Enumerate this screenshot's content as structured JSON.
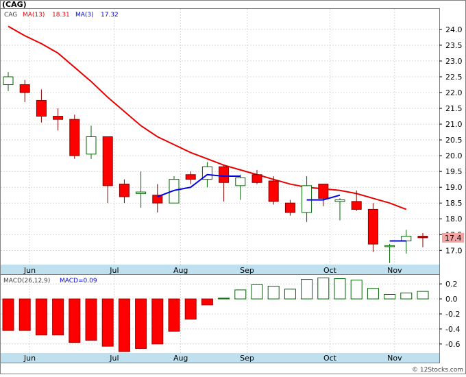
{
  "title": "(CAG)",
  "watermark": "© 12Stocks.com",
  "colors": {
    "up_candle": "#006400",
    "down_candle": "#ff0000",
    "ma13": "#e60000",
    "ma3": "#0000e6",
    "macd_positive": "#006400",
    "macd_negative": "#ff0000",
    "axis_band": "#bfe0ee",
    "price_tag_bg": "#f4a3a3",
    "grid": "#c0c0c0"
  },
  "chart_data": [
    {
      "type": "candlestick",
      "legend": {
        "symbol": "CAG",
        "ma13_label": "MA(13)",
        "ma13_value": "18.31",
        "ma3_label": "MA(3)",
        "ma3_value": "17.32"
      },
      "y_ticks": [
        "24.0",
        "23.5",
        "23.0",
        "22.5",
        "22.0",
        "21.5",
        "21.0",
        "20.5",
        "20.0",
        "19.5",
        "19.0",
        "18.5",
        "18.0",
        "17.5",
        "17.0"
      ],
      "ylim": [
        16.55,
        24.65
      ],
      "month_labels": [
        {
          "label": "Jun",
          "week": 1.3
        },
        {
          "label": "Jul",
          "week": 6.4
        },
        {
          "label": "Aug",
          "week": 10.4
        },
        {
          "label": "Sep",
          "week": 14.4
        },
        {
          "label": "Oct",
          "week": 19.4
        },
        {
          "label": "Nov",
          "week": 23.3
        }
      ],
      "last_price": "17.4",
      "last_price_value": 17.4,
      "candles": [
        {
          "o": 22.25,
          "h": 22.65,
          "l": 22.05,
          "c": 22.5
        },
        {
          "o": 22.25,
          "h": 22.4,
          "l": 21.7,
          "c": 22.0
        },
        {
          "o": 21.75,
          "h": 22.1,
          "l": 21.05,
          "c": 21.25
        },
        {
          "o": 21.25,
          "h": 21.5,
          "l": 20.8,
          "c": 21.15
        },
        {
          "o": 21.15,
          "h": 21.3,
          "l": 19.9,
          "c": 20.0
        },
        {
          "o": 20.05,
          "h": 20.95,
          "l": 19.9,
          "c": 20.6
        },
        {
          "o": 20.6,
          "h": 20.6,
          "l": 18.5,
          "c": 19.05
        },
        {
          "o": 19.1,
          "h": 19.25,
          "l": 18.5,
          "c": 18.7
        },
        {
          "o": 18.8,
          "h": 19.5,
          "l": 18.35,
          "c": 18.85
        },
        {
          "o": 18.75,
          "h": 19.1,
          "l": 18.2,
          "c": 18.5
        },
        {
          "o": 18.5,
          "h": 19.35,
          "l": 18.5,
          "c": 19.25
        },
        {
          "o": 19.4,
          "h": 19.5,
          "l": 19.1,
          "c": 19.25
        },
        {
          "o": 19.25,
          "h": 19.8,
          "l": 19.0,
          "c": 19.65
        },
        {
          "o": 19.65,
          "h": 19.7,
          "l": 18.55,
          "c": 19.15
        },
        {
          "o": 19.05,
          "h": 19.4,
          "l": 18.6,
          "c": 19.3
        },
        {
          "o": 19.4,
          "h": 19.55,
          "l": 19.1,
          "c": 19.15
        },
        {
          "o": 19.2,
          "h": 19.35,
          "l": 18.45,
          "c": 18.55
        },
        {
          "o": 18.5,
          "h": 18.6,
          "l": 18.1,
          "c": 18.2
        },
        {
          "o": 18.2,
          "h": 19.35,
          "l": 17.9,
          "c": 19.05
        },
        {
          "o": 19.1,
          "h": 19.1,
          "l": 18.4,
          "c": 18.65
        },
        {
          "o": 18.55,
          "h": 18.65,
          "l": 17.95,
          "c": 18.6
        },
        {
          "o": 18.55,
          "h": 18.9,
          "l": 18.25,
          "c": 18.3
        },
        {
          "o": 18.3,
          "h": 18.5,
          "l": 16.95,
          "c": 17.2
        },
        {
          "o": 17.15,
          "h": 17.2,
          "l": 16.6,
          "c": 17.15
        },
        {
          "o": 17.3,
          "h": 17.65,
          "l": 16.9,
          "c": 17.45
        },
        {
          "o": 17.45,
          "h": 17.55,
          "l": 17.1,
          "c": 17.4
        }
      ],
      "ma13": [
        24.1,
        23.8,
        23.55,
        23.25,
        22.8,
        22.35,
        21.85,
        21.4,
        20.95,
        20.6,
        20.35,
        20.1,
        19.9,
        19.7,
        19.55,
        19.4,
        19.25,
        19.1,
        19.0,
        18.95,
        18.9,
        18.8,
        18.65,
        18.5,
        18.3
      ],
      "ma13_start_week": 0,
      "ma3": [
        18.7,
        18.9,
        19.0,
        19.4,
        19.35,
        19.35,
        null,
        null,
        null,
        18.6,
        18.6,
        18.75,
        null,
        null,
        17.3,
        17.3
      ],
      "ma3_start_week": 9
    },
    {
      "type": "bar",
      "legend": {
        "label": "MACD(26,12,9)",
        "value_label": "MACD=0.09"
      },
      "y_ticks": [
        "0.2",
        "0.0",
        "-0.2",
        "-0.4",
        "-0.6"
      ],
      "ylim": [
        -0.72,
        0.32
      ],
      "values": [
        -0.42,
        -0.42,
        -0.48,
        -0.48,
        -0.58,
        -0.55,
        -0.63,
        -0.7,
        -0.66,
        -0.6,
        -0.43,
        -0.27,
        -0.08,
        0.01,
        0.12,
        0.19,
        0.17,
        0.13,
        0.26,
        0.28,
        0.27,
        0.25,
        0.14,
        0.06,
        0.08,
        0.1
      ]
    }
  ]
}
